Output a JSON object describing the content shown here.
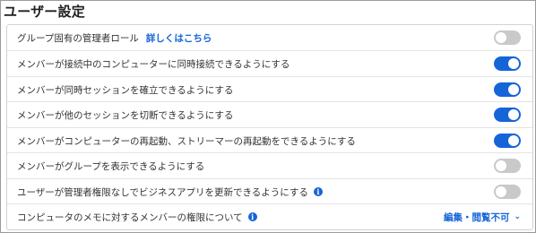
{
  "title": "ユーザー設定",
  "settings": [
    {
      "label": "グループ固有の管理者ロール",
      "link": "詳しくはこちら",
      "state": "off"
    },
    {
      "label": "メンバーが接続中のコンピューターに同時接続できるようにする",
      "state": "on"
    },
    {
      "label": "メンバーが同時セッションを確立できるようにする",
      "state": "on"
    },
    {
      "label": "メンバーが他のセッションを切断できるようにする",
      "state": "on"
    },
    {
      "label": "メンバーがコンピューターの再起動、ストリーマーの再起動をできるようにする",
      "state": "on"
    },
    {
      "label": "メンバーがグループを表示できるようにする",
      "state": "off"
    },
    {
      "label": "ユーザーが管理者権限なしでビジネスアプリを更新できるようにする",
      "info_icon": "info-icon",
      "state": "off"
    },
    {
      "label": "コンピュータのメモに対するメンバーの権限について",
      "info_icon": "info-icon",
      "dropdown_value": "編集・閲覧不可"
    }
  ],
  "colors": {
    "accent": "#1565d8",
    "toggle_off": "#c9c9c9"
  }
}
